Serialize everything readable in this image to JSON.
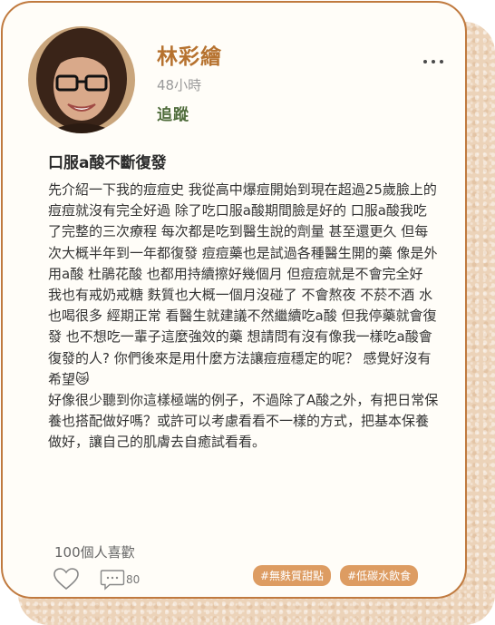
{
  "post": {
    "author": "林彩繪",
    "time": "48小時",
    "follow_label": "追蹤",
    "title": "口服a酸不斷復發",
    "body": "先介紹一下我的痘痘史 我從高中爆痘開始到現在超過25歲臉上的痘痘就沒有完全好過 除了吃口服a酸期間臉是好的 口服a酸我吃了完整的三次療程 每次都是吃到醫生說的劑量 甚至還更久 但每次大概半年到一年都復發 痘痘藥也是試過各種醫生開的藥 像是外用a酸 杜鵑花酸 也都用持續擦好幾個月 但痘痘就是不會完全好 我也有戒奶戒糖 麩質也大概一個月沒碰了 不會熬夜 不菸不酒 水也喝很多 經期正常 看醫生就建議不然繼續吃a酸 但我停藥就會復發 也不想吃一輩子這麼強效的藥 想請問有沒有像我一樣吃a酸會復發的人? 你們後來是用什麼方法讓痘痘穩定的呢？ 感覺好沒有希望😿\n好像很少聽到你這樣極端的例子，不過除了A酸之外，有把日常保養也搭配做好嗎？或許可以考慮看看不一樣的方式，把基本保養做好，讓自己的肌膚去自癒試看看。",
    "likes_text": "100個人喜歡",
    "comment_count": "80",
    "tags": [
      "#無麩質甜點",
      "#低碳水飲食"
    ]
  },
  "icons": {
    "more": "more-dots-icon",
    "like": "heart-icon",
    "comment": "comment-bubble-icon"
  },
  "colors": {
    "accent": "#b6722f",
    "border": "#c07a3f",
    "follow": "#4e6b3a",
    "tag_bg": "#dd9c62",
    "backdrop": "#ecd3b9"
  }
}
